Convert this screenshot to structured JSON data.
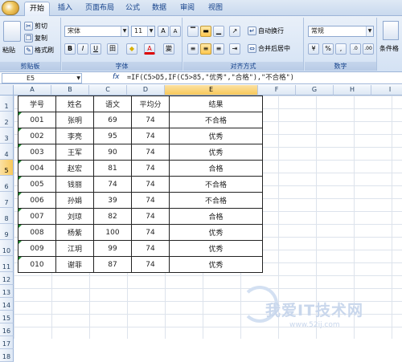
{
  "ribbon": {
    "tabs": [
      "开始",
      "插入",
      "页面布局",
      "公式",
      "数据",
      "审阅",
      "视图"
    ],
    "active_tab": "开始",
    "clipboard": {
      "paste": "粘贴",
      "cut": "剪切",
      "copy": "复制",
      "format_painter": "格式刷",
      "label": "剪贴板"
    },
    "font": {
      "name": "宋体",
      "size": "11",
      "grow": "A",
      "shrink": "A",
      "bold": "B",
      "italic": "I",
      "underline": "U",
      "border": "田",
      "fill": "◆",
      "color": "A",
      "phonetic": "變",
      "label": "字体"
    },
    "alignment": {
      "wrap": "自动换行",
      "merge": "合并后居中",
      "label": "对齐方式"
    },
    "number": {
      "format": "常规",
      "percent": "%",
      "comma": ",",
      "label": "数字"
    },
    "styles": {
      "conditional": "条件格"
    }
  },
  "formula_bar": {
    "cell_ref": "E5",
    "fx": "fx",
    "formula": "=IF(C5>D5,IF(C5>85,\"优秀\",\"合格\"),\"不合格\")"
  },
  "columns": [
    "A",
    "B",
    "C",
    "D",
    "E",
    "F",
    "G",
    "H",
    "I"
  ],
  "selected_column": "E",
  "rows": [
    "1",
    "2",
    "3",
    "4",
    "5",
    "6",
    "7",
    "8",
    "9",
    "10",
    "11",
    "12",
    "13",
    "14",
    "15",
    "16",
    "17",
    "18"
  ],
  "selected_row": "5",
  "table": {
    "headers": [
      "学号",
      "姓名",
      "语文",
      "平均分",
      "结果"
    ],
    "rows": [
      [
        "001",
        "张明",
        "69",
        "74",
        "不合格"
      ],
      [
        "002",
        "李亮",
        "95",
        "74",
        "优秀"
      ],
      [
        "003",
        "王军",
        "90",
        "74",
        "优秀"
      ],
      [
        "004",
        "赵宏",
        "81",
        "74",
        "合格"
      ],
      [
        "005",
        "钱丽",
        "74",
        "74",
        "不合格"
      ],
      [
        "006",
        "孙娟",
        "39",
        "74",
        "不合格"
      ],
      [
        "007",
        "刘琼",
        "82",
        "74",
        "合格"
      ],
      [
        "008",
        "杨紫",
        "100",
        "74",
        "优秀"
      ],
      [
        "009",
        "江玥",
        "99",
        "74",
        "优秀"
      ],
      [
        "010",
        "谢菲",
        "87",
        "74",
        "优秀"
      ]
    ]
  },
  "watermark": {
    "text": "我爱IT技术网",
    "url": "www.52ij.com"
  }
}
